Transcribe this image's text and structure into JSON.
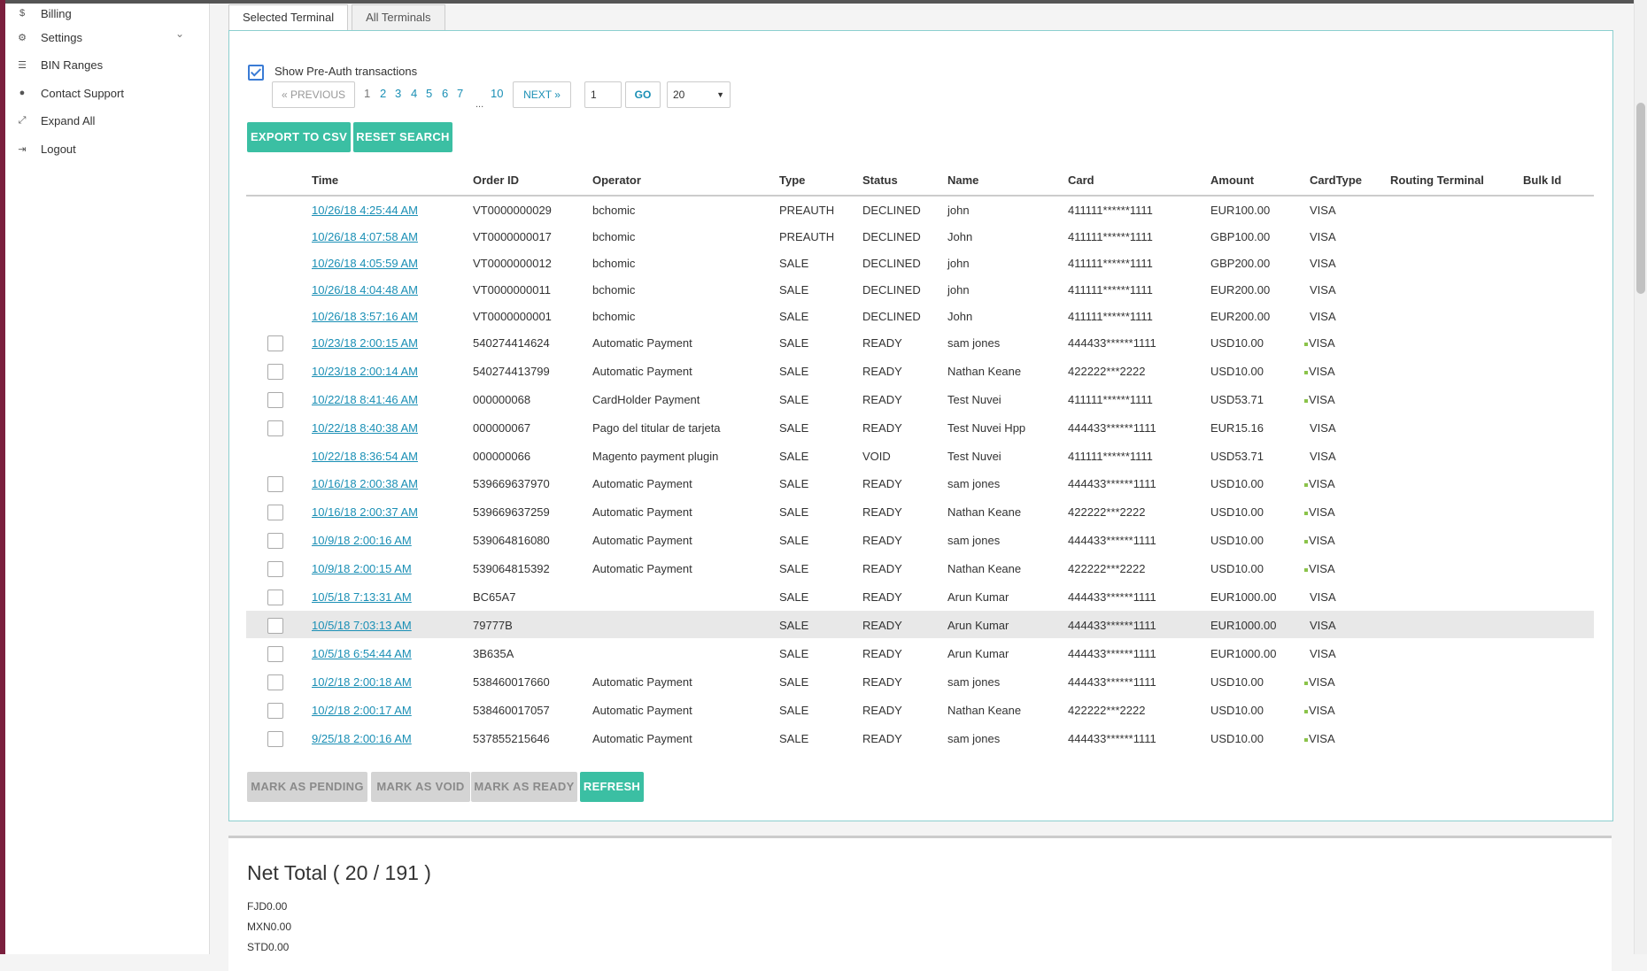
{
  "sidebar": {
    "items": [
      {
        "icon": "dollar-icon",
        "glyph": "$",
        "label": "Billing"
      },
      {
        "icon": "gear-icon",
        "glyph": "⚙",
        "label": "Settings"
      },
      {
        "icon": "list-icon",
        "glyph": "☰",
        "label": "BIN Ranges"
      },
      {
        "icon": "help-icon",
        "glyph": "●",
        "label": "Contact Support"
      },
      {
        "icon": "expand-icon",
        "glyph": "⤢",
        "label": "Expand All"
      },
      {
        "icon": "logout-icon",
        "glyph": "⇥",
        "label": "Logout"
      }
    ]
  },
  "tabs": [
    "Selected Terminal",
    "All Terminals"
  ],
  "filters": {
    "show_preauth_label": "Show Pre-Auth transactions",
    "show_preauth_checked": true
  },
  "pagination": {
    "prev": "« PREVIOUS",
    "pages": [
      "1",
      "2",
      "3",
      "4",
      "5",
      "6",
      "7"
    ],
    "ellipsis": "...",
    "last": "10",
    "next": "NEXT »",
    "goto_value": "1",
    "go": "GO",
    "page_size": "20"
  },
  "actions": {
    "export": "EXPORT TO CSV",
    "reset": "RESET SEARCH"
  },
  "table": {
    "headers": [
      "Time",
      "Order ID",
      "Operator",
      "Type",
      "Status",
      "Name",
      "Card",
      "Amount",
      "CardType",
      "Routing Terminal",
      "Bulk Id"
    ],
    "rows": [
      {
        "check": false,
        "time": "10/26/18 4:25:44 AM",
        "order": "VT0000000029",
        "operator": "bchomic",
        "type": "PREAUTH",
        "status": "DECLINED",
        "name": "john",
        "card": "411111******1111",
        "amount": "EUR100.00",
        "cardtype": "VISA",
        "dot": false
      },
      {
        "check": false,
        "time": "10/26/18 4:07:58 AM",
        "order": "VT0000000017",
        "operator": "bchomic",
        "type": "PREAUTH",
        "status": "DECLINED",
        "name": "John",
        "card": "411111******1111",
        "amount": "GBP100.00",
        "cardtype": "VISA",
        "dot": false
      },
      {
        "check": false,
        "time": "10/26/18 4:05:59 AM",
        "order": "VT0000000012",
        "operator": "bchomic",
        "type": "SALE",
        "status": "DECLINED",
        "name": "john",
        "card": "411111******1111",
        "amount": "GBP200.00",
        "cardtype": "VISA",
        "dot": false
      },
      {
        "check": false,
        "time": "10/26/18 4:04:48 AM",
        "order": "VT0000000011",
        "operator": "bchomic",
        "type": "SALE",
        "status": "DECLINED",
        "name": "john",
        "card": "411111******1111",
        "amount": "EUR200.00",
        "cardtype": "VISA",
        "dot": false
      },
      {
        "check": false,
        "time": "10/26/18 3:57:16 AM",
        "order": "VT0000000001",
        "operator": "bchomic",
        "type": "SALE",
        "status": "DECLINED",
        "name": "John",
        "card": "411111******1111",
        "amount": "EUR200.00",
        "cardtype": "VISA",
        "dot": false
      },
      {
        "check": true,
        "time": "10/23/18 2:00:15 AM",
        "order": "540274414624",
        "operator": "Automatic Payment",
        "type": "SALE",
        "status": "READY",
        "name": "sam jones",
        "card": "444433******1111",
        "amount": "USD10.00",
        "cardtype": "VISA",
        "dot": true
      },
      {
        "check": true,
        "time": "10/23/18 2:00:14 AM",
        "order": "540274413799",
        "operator": "Automatic Payment",
        "type": "SALE",
        "status": "READY",
        "name": "Nathan Keane",
        "card": "422222***2222",
        "amount": "USD10.00",
        "cardtype": "VISA",
        "dot": true
      },
      {
        "check": true,
        "time": "10/22/18 8:41:46 AM",
        "order": "000000068",
        "operator": "CardHolder Payment",
        "type": "SALE",
        "status": "READY",
        "name": "Test Nuvei",
        "card": "411111******1111",
        "amount": "USD53.71",
        "cardtype": "VISA",
        "dot": true
      },
      {
        "check": true,
        "time": "10/22/18 8:40:38 AM",
        "order": "000000067",
        "operator": "Pago del titular de tarjeta",
        "type": "SALE",
        "status": "READY",
        "name": "Test Nuvei Hpp",
        "card": "444433******1111",
        "amount": "EUR15.16",
        "cardtype": "VISA",
        "dot": false
      },
      {
        "check": false,
        "time": "10/22/18 8:36:54 AM",
        "order": "000000066",
        "operator": "Magento payment plugin",
        "type": "SALE",
        "status": "VOID",
        "name": "Test Nuvei",
        "card": "411111******1111",
        "amount": "USD53.71",
        "cardtype": "VISA",
        "dot": false
      },
      {
        "check": true,
        "time": "10/16/18 2:00:38 AM",
        "order": "539669637970",
        "operator": "Automatic Payment",
        "type": "SALE",
        "status": "READY",
        "name": "sam jones",
        "card": "444433******1111",
        "amount": "USD10.00",
        "cardtype": "VISA",
        "dot": true
      },
      {
        "check": true,
        "time": "10/16/18 2:00:37 AM",
        "order": "539669637259",
        "operator": "Automatic Payment",
        "type": "SALE",
        "status": "READY",
        "name": "Nathan Keane",
        "card": "422222***2222",
        "amount": "USD10.00",
        "cardtype": "VISA",
        "dot": true
      },
      {
        "check": true,
        "time": "10/9/18 2:00:16 AM",
        "order": "539064816080",
        "operator": "Automatic Payment",
        "type": "SALE",
        "status": "READY",
        "name": "sam jones",
        "card": "444433******1111",
        "amount": "USD10.00",
        "cardtype": "VISA",
        "dot": true
      },
      {
        "check": true,
        "time": "10/9/18 2:00:15 AM",
        "order": "539064815392",
        "operator": "Automatic Payment",
        "type": "SALE",
        "status": "READY",
        "name": "Nathan Keane",
        "card": "422222***2222",
        "amount": "USD10.00",
        "cardtype": "VISA",
        "dot": true
      },
      {
        "check": true,
        "time": "10/5/18 7:13:31 AM",
        "order": "BC65A7",
        "operator": "",
        "type": "SALE",
        "status": "READY",
        "name": "Arun Kumar",
        "card": "444433******1111",
        "amount": "EUR1000.00",
        "cardtype": "VISA",
        "dot": false
      },
      {
        "check": true,
        "time": "10/5/18 7:03:13 AM",
        "order": "79777B",
        "operator": "",
        "type": "SALE",
        "status": "READY",
        "name": "Arun Kumar",
        "card": "444433******1111",
        "amount": "EUR1000.00",
        "cardtype": "VISA",
        "dot": false,
        "highlight": true
      },
      {
        "check": true,
        "time": "10/5/18 6:54:44 AM",
        "order": "3B635A",
        "operator": "",
        "type": "SALE",
        "status": "READY",
        "name": "Arun Kumar",
        "card": "444433******1111",
        "amount": "EUR1000.00",
        "cardtype": "VISA",
        "dot": false
      },
      {
        "check": true,
        "time": "10/2/18 2:00:18 AM",
        "order": "538460017660",
        "operator": "Automatic Payment",
        "type": "SALE",
        "status": "READY",
        "name": "sam jones",
        "card": "444433******1111",
        "amount": "USD10.00",
        "cardtype": "VISA",
        "dot": true
      },
      {
        "check": true,
        "time": "10/2/18 2:00:17 AM",
        "order": "538460017057",
        "operator": "Automatic Payment",
        "type": "SALE",
        "status": "READY",
        "name": "Nathan Keane",
        "card": "422222***2222",
        "amount": "USD10.00",
        "cardtype": "VISA",
        "dot": true
      },
      {
        "check": true,
        "time": "9/25/18 2:00:16 AM",
        "order": "537855215646",
        "operator": "Automatic Payment",
        "type": "SALE",
        "status": "READY",
        "name": "sam jones",
        "card": "444433******1111",
        "amount": "USD10.00",
        "cardtype": "VISA",
        "dot": true
      }
    ]
  },
  "bottom_actions": {
    "pending": "MARK AS PENDING",
    "void": "MARK AS VOID",
    "ready": "MARK AS READY",
    "refresh": "REFRESH"
  },
  "net_total": {
    "title": "Net Total ( 20 / 191 )",
    "lines": [
      "FJD0.00",
      "MXN0.00",
      "STD0.00"
    ]
  },
  "colors": {
    "accent": "#3bbfa3",
    "link": "#1a8fb5",
    "panel_border": "#8ccfcf",
    "left_bar": "#7a1f3d"
  }
}
